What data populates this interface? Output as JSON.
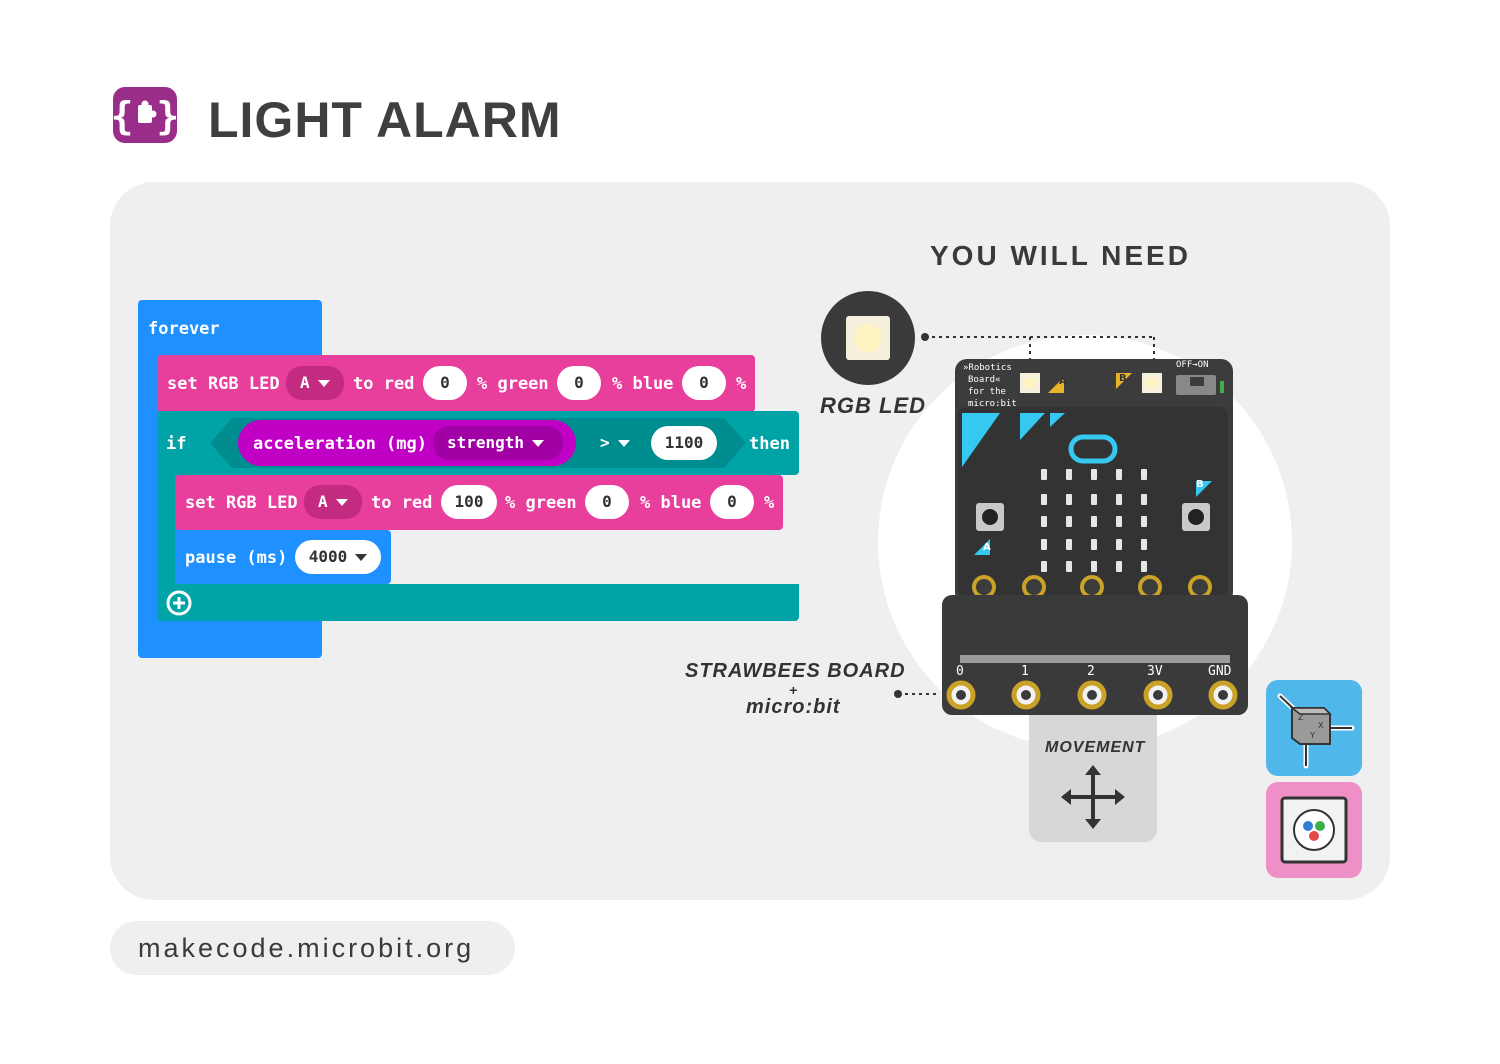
{
  "header": {
    "title": "LIGHT ALARM",
    "icon": "puzzle-braces-icon",
    "icon_color": "#9b2d8a"
  },
  "code": {
    "forever_label": "forever",
    "set_led_1": {
      "label": "set RGB LED",
      "led": "A",
      "to_red": "to red",
      "red": "0",
      "green_label": "% green",
      "green": "0",
      "blue_label": "% blue",
      "blue": "0",
      "pct": "%"
    },
    "if_label": "if",
    "acceleration_label": "acceleration (mg)",
    "strength_label": "strength",
    "operator": ">",
    "threshold": "1100",
    "then_label": "then",
    "set_led_2": {
      "label": "set RGB LED",
      "led": "A",
      "to_red": "to red",
      "red": "100",
      "green_label": "% green",
      "green": "0",
      "blue_label": "% blue",
      "blue": "0",
      "pct": "%"
    },
    "pause_label": "pause (ms)",
    "pause_value": "4000",
    "colors": {
      "loops": "#1e90ff",
      "led": "#e83e9c",
      "logic": "#00a4a6",
      "input": "#c000c4",
      "input_dark": "#a000a4"
    }
  },
  "need": {
    "title": "YOU WILL NEED",
    "rgb_led_label": "RGB LED",
    "board_label_1": "STRAWBEES BOARD",
    "board_label_plus": "+",
    "board_label_2": "micro:bit",
    "movement_label": "MOVEMENT",
    "board_text_1": "»Robotics",
    "board_text_2": "Board«",
    "board_text_3": "for the",
    "board_text_4": "micro:bit",
    "switch_label": "OFF→ON",
    "pin_labels": [
      "0",
      "1",
      "2",
      "3V",
      "GND"
    ],
    "button_a": "A",
    "button_b": "B",
    "port_a": "A",
    "port_b": "B"
  },
  "footer": {
    "url": "makecode.microbit.org"
  }
}
